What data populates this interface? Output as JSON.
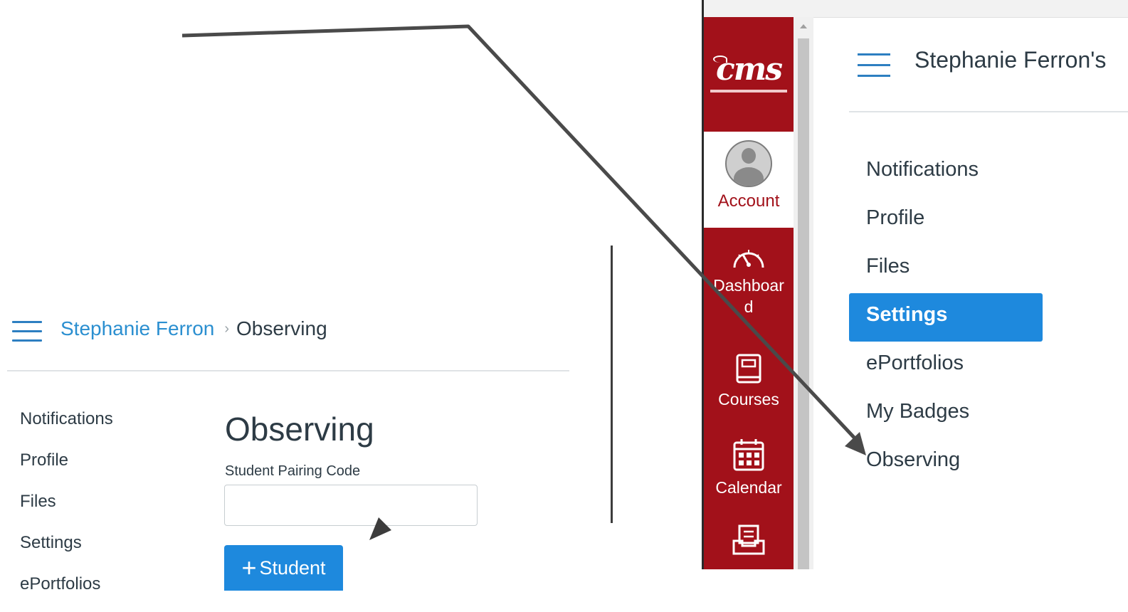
{
  "left_panel": {
    "breadcrumb": {
      "user": "Stephanie Ferron",
      "separator": "›",
      "current": "Observing"
    },
    "nav": [
      "Notifications",
      "Profile",
      "Files",
      "Settings",
      "ePortfolios"
    ],
    "page_title": "Observing",
    "pairing_label": "Student Pairing Code",
    "pairing_value": "",
    "add_button": {
      "icon": "+",
      "label": "Student"
    }
  },
  "right_panel": {
    "logo_text": "cms",
    "global_nav": {
      "account": "Account",
      "dashboard": "Dashboard",
      "courses": "Courses",
      "calendar": "Calendar"
    },
    "title": "Stephanie Ferron's",
    "nav": [
      "Notifications",
      "Profile",
      "Files",
      "Settings",
      "ePortfolios",
      "My Badges",
      "Observing"
    ],
    "active_nav": "Settings"
  },
  "colors": {
    "canvas_red": "#a2111a",
    "link_blue": "#2b8fd0",
    "button_blue": "#1e89dd",
    "text_dark": "#2d3b45",
    "annotation": "#4a4a4a"
  }
}
